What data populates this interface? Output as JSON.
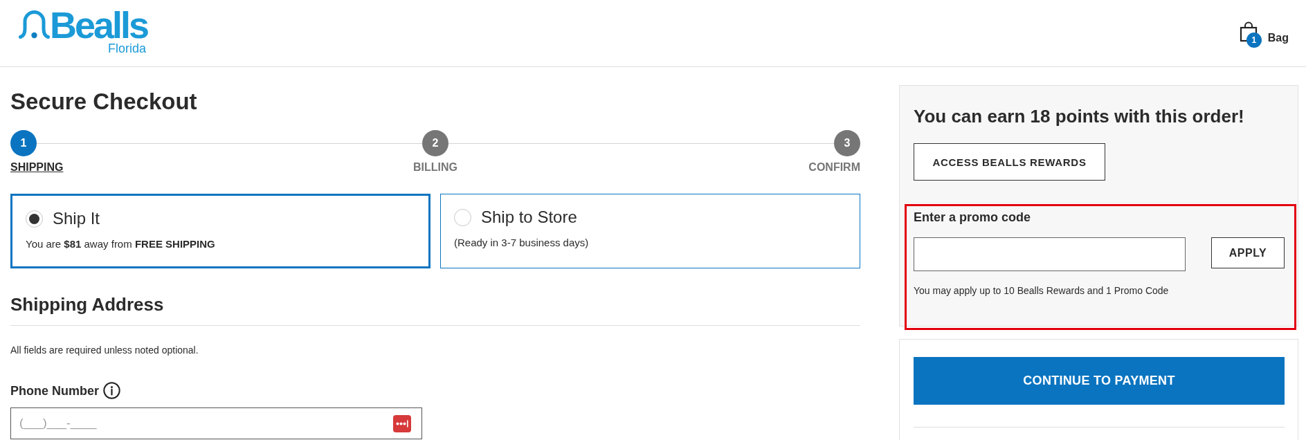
{
  "header": {
    "logo": {
      "brand": "Bealls",
      "region": "Florida"
    },
    "bag": {
      "count": "1",
      "label": "Bag"
    }
  },
  "checkout": {
    "title": "Secure Checkout",
    "steps": [
      {
        "number": "1",
        "label": "SHIPPING",
        "selected": true
      },
      {
        "number": "2",
        "label": "BILLING",
        "selected": false
      },
      {
        "number": "3",
        "label": "CONFIRM",
        "selected": false
      }
    ],
    "shipping_options": [
      {
        "label": "Ship It",
        "note": "You are **$81** away from **FREE SHIPPING**",
        "selected": true
      },
      {
        "label": "Ship to Store",
        "note": "(Ready in 3-7 business days)",
        "selected": false
      }
    ],
    "address": {
      "title": "Shipping Address",
      "hint": "All fields are required unless noted optional.",
      "phone": {
        "label": "Phone Number",
        "placeholder": "(___)___-____"
      }
    }
  },
  "rewards": {
    "title": "You can earn 18 points with this order!",
    "button": "ACCESS BEALLS REWARDS"
  },
  "promo": {
    "highlighted": true,
    "label": "Enter a promo code",
    "button": "APPLY",
    "note": "You may apply up to 10 Bealls Rewards and 1 Promo Code"
  },
  "payment": {
    "button": "CONTINUE TO PAYMENT"
  }
}
